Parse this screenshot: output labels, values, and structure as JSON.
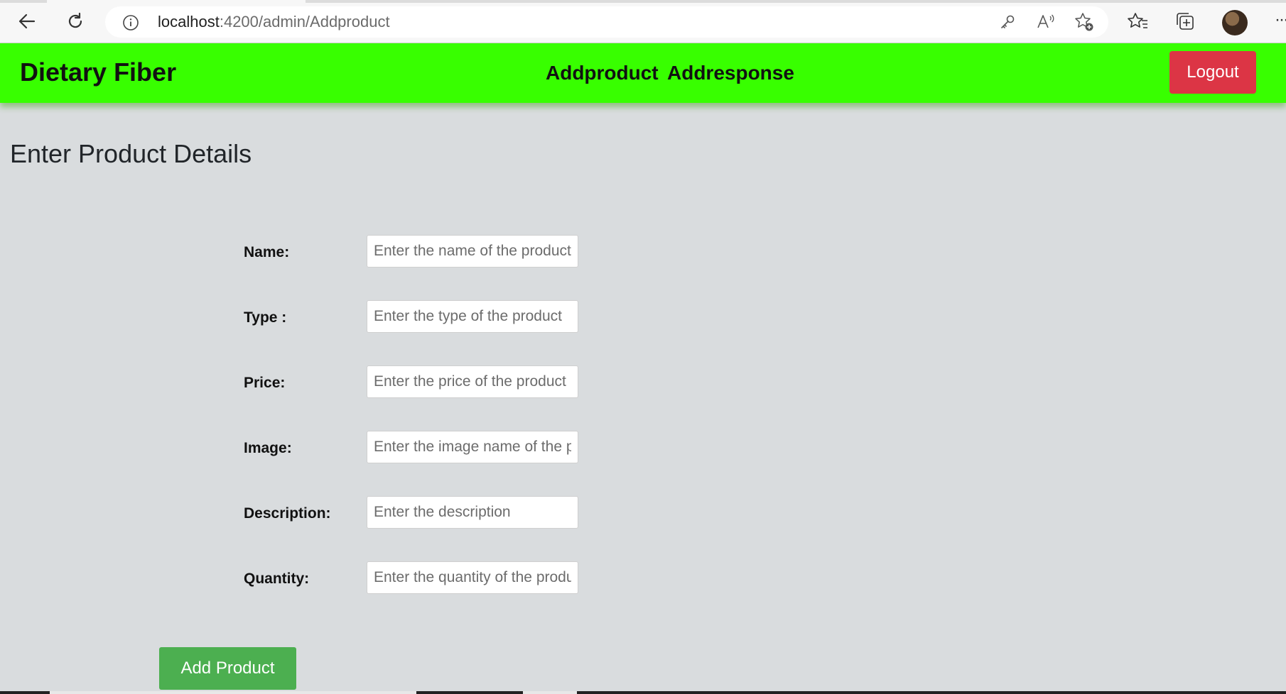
{
  "browser": {
    "url_host": "localhost",
    "url_path": ":4200/admin/Addproduct",
    "icons": [
      "back-arrow-icon",
      "refresh-icon",
      "info-icon",
      "key-icon",
      "read-aloud-icon",
      "add-favorite-icon",
      "favorites-icon",
      "collections-icon",
      "profile-avatar",
      "more-icon"
    ]
  },
  "navbar": {
    "brand": "Dietary Fiber",
    "links": [
      "Addproduct",
      "Addresponse"
    ],
    "logout_label": "Logout",
    "background": "#38ff00",
    "logout_color": "#dc3545"
  },
  "page": {
    "title": "Enter Product Details"
  },
  "form": {
    "fields": [
      {
        "label": "Name:",
        "placeholder": "Enter the name of the product",
        "value": ""
      },
      {
        "label": "Type :",
        "placeholder": "Enter the type of the product",
        "value": ""
      },
      {
        "label": "Price:",
        "placeholder": "Enter the price of the product",
        "value": ""
      },
      {
        "label": "Image:",
        "placeholder": "Enter the image name of the product",
        "value": ""
      },
      {
        "label": "Description:",
        "placeholder": "Enter the description",
        "value": ""
      },
      {
        "label": "Quantity:",
        "placeholder": "Enter the quantity of the product",
        "value": ""
      }
    ],
    "submit_label": "Add Product",
    "submit_color": "#4caf50"
  }
}
